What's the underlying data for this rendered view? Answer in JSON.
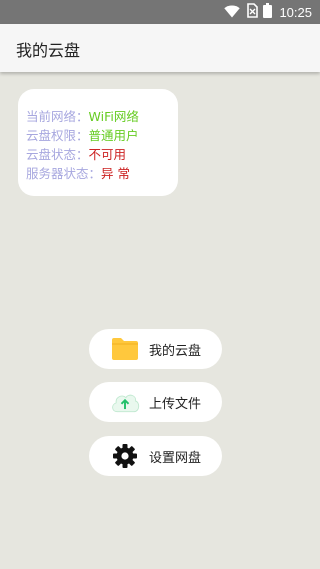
{
  "status_bar": {
    "time": "10:25",
    "icons": [
      "wifi-icon",
      "signal-no-sim-icon",
      "battery-icon"
    ]
  },
  "app_bar": {
    "title": "我的云盘"
  },
  "info_card": {
    "rows": [
      {
        "label": "当前网络：",
        "value": "WiFi网络",
        "value_color": "#66cc22"
      },
      {
        "label": "云盘权限：",
        "value": "普通用户",
        "value_color": "#66cc22"
      },
      {
        "label": "云盘状态：",
        "value": "不可用",
        "value_color": "#cc2222"
      },
      {
        "label": "服务器状态：",
        "value": "异 常",
        "value_color": "#cc2222"
      }
    ]
  },
  "actions": [
    {
      "label": "我的云盘",
      "icon": "folder-icon"
    },
    {
      "label": "上传文件",
      "icon": "cloud-upload-icon"
    },
    {
      "label": "设置网盘",
      "icon": "gear-icon"
    }
  ],
  "colors": {
    "background": "#e6e6df",
    "status_bar": "#757575",
    "app_bar": "#f6f6f6",
    "label": "#a7a7df",
    "ok": "#66cc22",
    "error": "#cc2222",
    "folder": "#ffc83d"
  }
}
